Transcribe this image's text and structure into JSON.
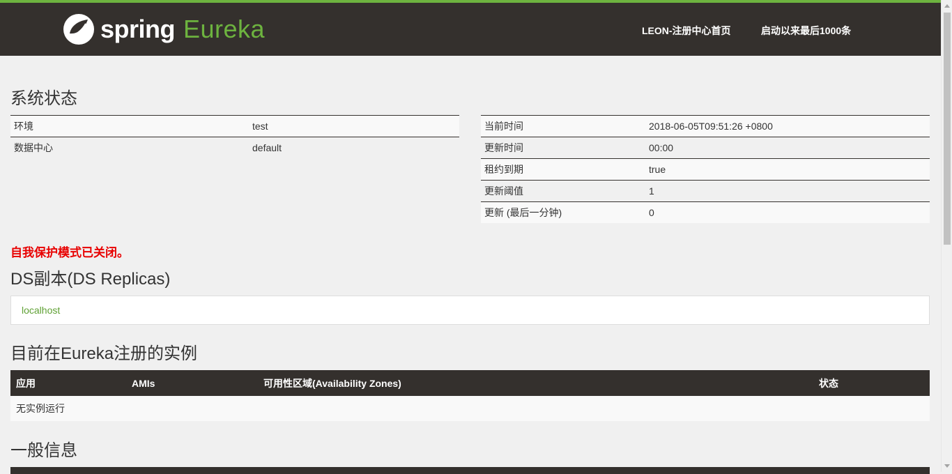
{
  "header": {
    "logo_spring": "spring",
    "logo_eureka": "Eureka",
    "nav_home": "LEON-注册中心首页",
    "nav_last": "启动以来最后1000条"
  },
  "system_status": {
    "title": "系统状态",
    "left": [
      {
        "label": "环境",
        "value": "test"
      },
      {
        "label": "数据中心",
        "value": "default"
      }
    ],
    "right": [
      {
        "label": "当前时间",
        "value": "2018-06-05T09:51:26 +0800"
      },
      {
        "label": "更新时间",
        "value": "00:00"
      },
      {
        "label": "租约到期",
        "value": "true"
      },
      {
        "label": "更新阈值",
        "value": "1"
      },
      {
        "label": "更新 (最后一分钟)",
        "value": "0"
      }
    ]
  },
  "warning": "自我保护模式已关闭。",
  "replicas": {
    "title": "DS副本(DS Replicas)",
    "link": "localhost"
  },
  "instances": {
    "title": "目前在Eureka注册的实例",
    "headers": [
      "应用",
      "AMIs",
      "可用性区域(Availability Zones)",
      "状态"
    ],
    "empty": "无实例运行"
  },
  "general_info": {
    "title": "一般信息"
  },
  "colors": {
    "brand_green": "#6db33f",
    "header_dark": "#34302d",
    "warning_red": "#e80000"
  }
}
